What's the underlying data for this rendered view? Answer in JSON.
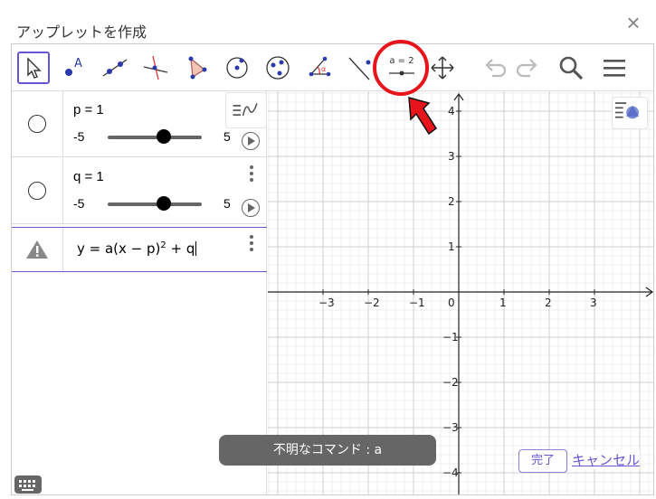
{
  "window": {
    "title": "アップレットを作成"
  },
  "toolbar": {
    "tools": [
      {
        "name": "move-tool-icon"
      },
      {
        "name": "point-tool-icon",
        "glyph": "A"
      },
      {
        "name": "line-tool-icon"
      },
      {
        "name": "perpendicular-tool-icon"
      },
      {
        "name": "polygon-tool-icon"
      },
      {
        "name": "circle-tool-icon"
      },
      {
        "name": "ellipse-tool-icon"
      },
      {
        "name": "angle-tool-icon",
        "glyph": "α"
      },
      {
        "name": "reflect-tool-icon"
      },
      {
        "name": "slider-tool-icon",
        "label": "a = 2"
      },
      {
        "name": "move-graphics-tool-icon"
      }
    ],
    "right_icons": [
      "undo-icon",
      "redo-icon",
      "search-icon",
      "menu-icon"
    ]
  },
  "algebra": {
    "rows": [
      {
        "label": "p = 1",
        "min": "-5",
        "max": "5",
        "value": 1,
        "range": [
          -5,
          5
        ]
      },
      {
        "label": "q = 1",
        "min": "-5",
        "max": "5",
        "value": 1,
        "range": [
          -5,
          5
        ]
      }
    ],
    "input": {
      "formula_prefix": "y = a(x − p)",
      "exponent": "2",
      "formula_suffix": " + q"
    }
  },
  "graph": {
    "x_ticks": [
      "−3",
      "−2",
      "−1",
      "0",
      "1",
      "2",
      "3"
    ],
    "y_ticks": [
      "4",
      "3",
      "2",
      "1",
      "−1",
      "−2",
      "−3",
      "−4"
    ]
  },
  "toast": {
    "text": "不明なコマンド : a"
  },
  "buttons": {
    "done": "完了",
    "cancel": "キャンセル"
  },
  "colors": {
    "accent": "#6557d2",
    "highlight": "#e8141b",
    "toast_bg": "#666666"
  }
}
